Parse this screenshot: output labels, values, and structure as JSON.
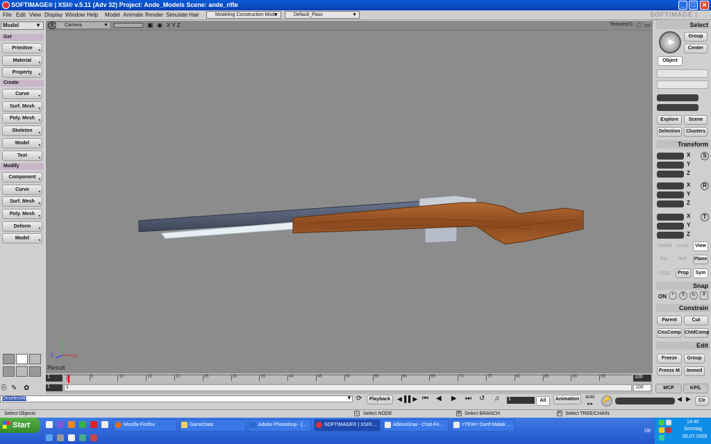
{
  "window": {
    "title": "SOFTIMAGE® | XSI® v.5.11 (Adv 32) Project: Ande_Models    Scene: ande_rifle",
    "brand": "SOFTIMAGE | XSI |"
  },
  "menubar": {
    "items": [
      "File",
      "Edit",
      "View",
      "Display",
      "Window",
      "Help",
      "Model",
      "Animate",
      "Render",
      "Simulate",
      "Hair"
    ],
    "mode": "Modeling Construction Mode",
    "pass": "Default_Pass"
  },
  "left_panel": {
    "module": "Model",
    "sections": [
      {
        "title": "Get",
        "buttons": [
          "Primitive",
          "Material",
          "Property"
        ]
      },
      {
        "title": "Create",
        "buttons": [
          "Curve",
          "Surf. Mesh",
          "Poly. Mesh",
          "Skeleton",
          "Model",
          "Text"
        ]
      },
      {
        "title": "Modify",
        "buttons": [
          "Component",
          "Curve",
          "Surf. Mesh",
          "Poly. Mesh",
          "Deform",
          "Model"
        ]
      }
    ]
  },
  "viewport": {
    "letter": "B",
    "camera": "Camera",
    "axes_label": "X Y Z",
    "display_mode": "Textured 0...",
    "result_label": "Result"
  },
  "right_panel": {
    "select_title": "Select",
    "group": "Group",
    "center": "Center",
    "object": "Object",
    "explore": "Explore",
    "scene": "Scene",
    "selection": "Selection",
    "clusters": "Clusters",
    "transform_title": "Transform",
    "s_label": "S",
    "r_label": "R",
    "t_label": "T",
    "axes": [
      "X",
      "Y",
      "Z"
    ],
    "global": "Global",
    "local": "Local",
    "view": "View",
    "par": "Par",
    "ref": "Ref",
    "plane": "Plane",
    "cog": "COG",
    "prop": "Prop",
    "sym": "Sym",
    "snap_title": "Snap",
    "snap_on": "ON",
    "constrain_title": "Constrain",
    "parent": "Parent",
    "cut": "Cut",
    "cnscomp": "CnsComp",
    "childcomp": "ChldComp",
    "edit_title": "Edit",
    "freeze": "Freeze",
    "edit_group": "Group",
    "freeze_m": "Freeze M",
    "immed": "Immed",
    "mcp": "MCP",
    "kpl": "KP/L"
  },
  "timeline": {
    "start": "1",
    "end": "100",
    "ticks": [
      "1",
      "5",
      "10",
      "15",
      "20",
      "25",
      "30",
      "35",
      "40",
      "45",
      "50",
      "55",
      "60",
      "65",
      "70",
      "75",
      "80",
      "85",
      "90",
      "95"
    ],
    "end2": "100",
    "frame": "1",
    "current": "1"
  },
  "command": {
    "line": "DeselectAll",
    "playback": "Playback",
    "frame_field": "1",
    "all": "All",
    "animation": "Animation",
    "auto": "auto",
    "clr": "Clr"
  },
  "status": {
    "left": "Select Objects",
    "l": "Select NODE",
    "m": "Select BRANCH",
    "r": "Select TREE/CHAIN"
  },
  "taskbar": {
    "start": "Start",
    "tasks": [
      "Mozilla Firefox",
      "GameData",
      "Adobe Photoshop - [....",
      "SOFTIMAGE® | XSI®....",
      "AlbinoGraa - Chat-Fe...",
      "=TEW= Darth'Malak ..."
    ],
    "lang": "DE",
    "time": "14:40",
    "day": "Sonntag",
    "date": "05.07.2009"
  }
}
